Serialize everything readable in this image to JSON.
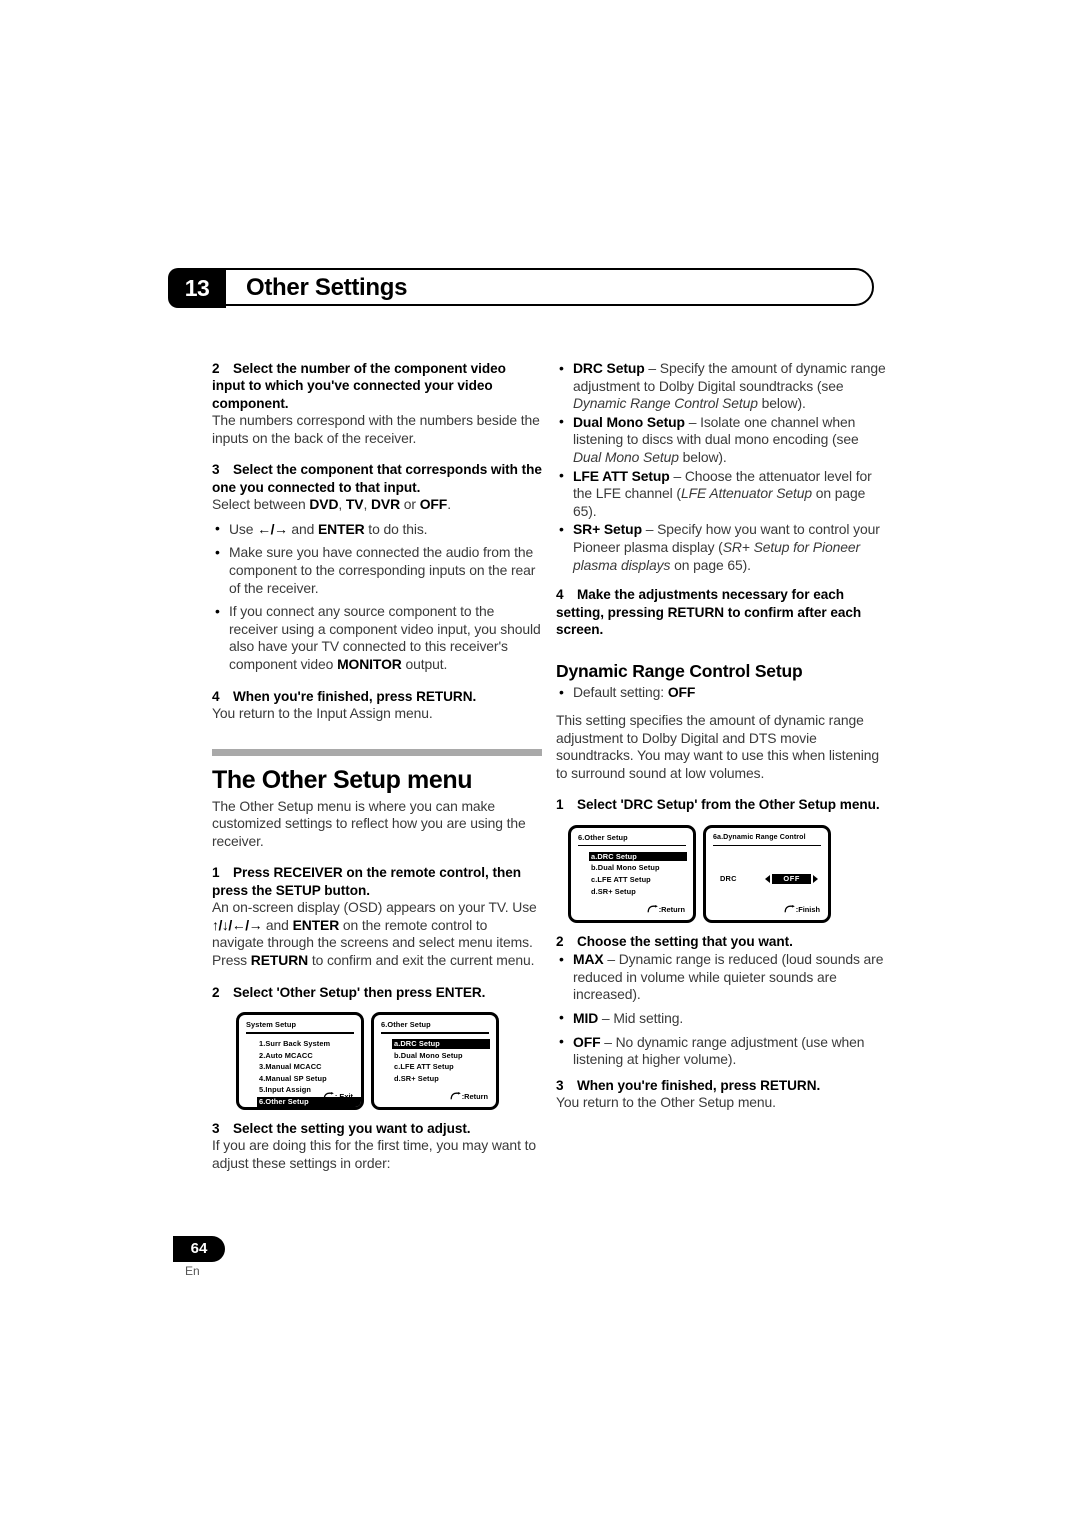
{
  "chapter": {
    "number": "13",
    "title": "Other Settings"
  },
  "footer": {
    "page_number": "64",
    "language": "En"
  },
  "left_column": {
    "step2": {
      "num": "2",
      "heading": "Select the number of the component video input to which you've connected your video component.",
      "body": "The numbers correspond with the numbers beside the inputs on the back of the receiver."
    },
    "step3": {
      "num": "3",
      "heading": "Select the component that corresponds with the one you connected to that input.",
      "body_prefix": "Select between ",
      "opt1": "DVD",
      "sep1": ", ",
      "opt2": "TV",
      "sep2": ", ",
      "opt3": "DVR",
      "sep3": " or ",
      "opt4": "OFF",
      "sep4": ".",
      "bullets": [
        {
          "pre": "Use ",
          "arrows": "←/→",
          "mid": " and ",
          "bold": "ENTER",
          "post": " to do this."
        },
        {
          "text": "Make sure you have connected the audio from the component to the corresponding inputs on the rear of the receiver."
        },
        {
          "pre": "If you connect any source component to the receiver using a component video input, you should also have your TV connected to this receiver's component video ",
          "bold": "MONITOR",
          "post": " output."
        }
      ]
    },
    "step4": {
      "num": "4",
      "heading": "When you're finished, press RETURN.",
      "body": "You return to the Input Assign menu."
    },
    "section_heading": "The Other Setup menu",
    "section_intro": "The Other Setup menu is where you can make customized settings to reflect how you are using the receiver.",
    "setup_step1": {
      "num": "1",
      "heading": "Press RECEIVER on the remote control, then press the SETUP button.",
      "body_pre": "An on-screen display (OSD) appears on your TV. Use ",
      "arrows": "↑/↓/←/→",
      "body_mid": " and ",
      "bold1": "ENTER",
      "body_mid2": " on the remote control to navigate through the screens and select menu items. Press ",
      "bold2": "RETURN",
      "body_post": " to confirm and exit the current menu."
    },
    "setup_step2": {
      "num": "2",
      "heading": "Select 'Other Setup' then press ENTER."
    },
    "setup_step3": {
      "num": "3",
      "heading": "Select the setting you want to adjust.",
      "body": "If you are doing this for the first time, you may want to adjust these settings in order:"
    },
    "osd_figure": [
      {
        "title": "System  Setup",
        "items": [
          {
            "label": "1.Surr  Back  System",
            "selected": false
          },
          {
            "label": "2.Auto  MCACC",
            "selected": false
          },
          {
            "label": "3.Manual  MCACC",
            "selected": false
          },
          {
            "label": "4.Manual  SP  Setup",
            "selected": false
          },
          {
            "label": "5.Input  Assign",
            "selected": false
          },
          {
            "label": "6.Other  Setup",
            "selected": true
          }
        ],
        "footer": ": Exit",
        "footer_icon": "return-arrow-icon"
      },
      {
        "title": "6.Other  Setup",
        "items": [
          {
            "label": "a.DRC  Setup",
            "selected": true
          },
          {
            "label": "b.Dual  Mono  Setup",
            "selected": false
          },
          {
            "label": "c.LFE  ATT  Setup",
            "selected": false
          },
          {
            "label": "d.SR+  Setup",
            "selected": false
          }
        ],
        "footer": ":Return",
        "footer_icon": "return-arrow-icon"
      }
    ]
  },
  "right_column": {
    "setting_bullets": [
      {
        "bold": "DRC Setup",
        "pre": " – Specify the amount of dynamic range adjustment to Dolby Digital soundtracks (see ",
        "italic": "Dynamic Range Control Setup",
        "post": " below)."
      },
      {
        "bold": "Dual Mono Setup",
        "pre": " – Isolate one channel when listening to discs with dual mono encoding (see ",
        "italic": "Dual Mono Setup",
        "post": " below)."
      },
      {
        "bold": "LFE ATT Setup",
        "pre": " – Choose the attenuator level for the LFE channel (",
        "italic": "LFE Attenuator Setup",
        "post": " on page 65)."
      },
      {
        "bold": "SR+ Setup",
        "pre": " – Specify how you want to control your Pioneer plasma display (",
        "italic": "SR+ Setup for Pioneer plasma displays",
        "post": " on page 65)."
      }
    ],
    "step4": {
      "num": "4",
      "heading": "Make the adjustments necessary for each setting, pressing RETURN to confirm after each screen."
    },
    "drc_heading": "Dynamic Range Control Setup",
    "drc_default": {
      "pre": "Default setting: ",
      "bold": "OFF"
    },
    "drc_intro": "This setting specifies the amount of dynamic range adjustment to Dolby Digital and DTS movie soundtracks. You may want to use this when listening to surround sound at low volumes.",
    "drc_step1": {
      "num": "1",
      "heading": "Select 'DRC Setup' from the Other Setup menu."
    },
    "drc_step2": {
      "num": "2",
      "heading": "Choose the setting that you want.",
      "bullets": [
        {
          "bold": "MAX",
          "text": " – Dynamic range is reduced (loud sounds are reduced in volume while quieter sounds are increased)."
        },
        {
          "bold": "MID",
          "text": " – Mid setting."
        },
        {
          "bold": "OFF",
          "text": " – No dynamic range adjustment (use when listening at higher volume)."
        }
      ]
    },
    "drc_step3": {
      "num": "3",
      "heading": "When you're finished, press RETURN.",
      "body": "You return to the Other Setup menu."
    },
    "osd_figure": [
      {
        "title": "6.Other  Setup",
        "items": [
          {
            "label": "a.DRC  Setup",
            "selected": true
          },
          {
            "label": "b.Dual  Mono  Setup",
            "selected": false
          },
          {
            "label": "c.LFE  ATT  Setup",
            "selected": false
          },
          {
            "label": "d.SR+  Setup",
            "selected": false
          }
        ],
        "footer": ":Return",
        "footer_icon": "return-arrow-icon"
      },
      {
        "title": "6a.Dynamic  Range  Control",
        "value_label": "DRC",
        "value": "OFF",
        "footer": ":Finish",
        "footer_icon": "return-arrow-icon"
      }
    ]
  }
}
